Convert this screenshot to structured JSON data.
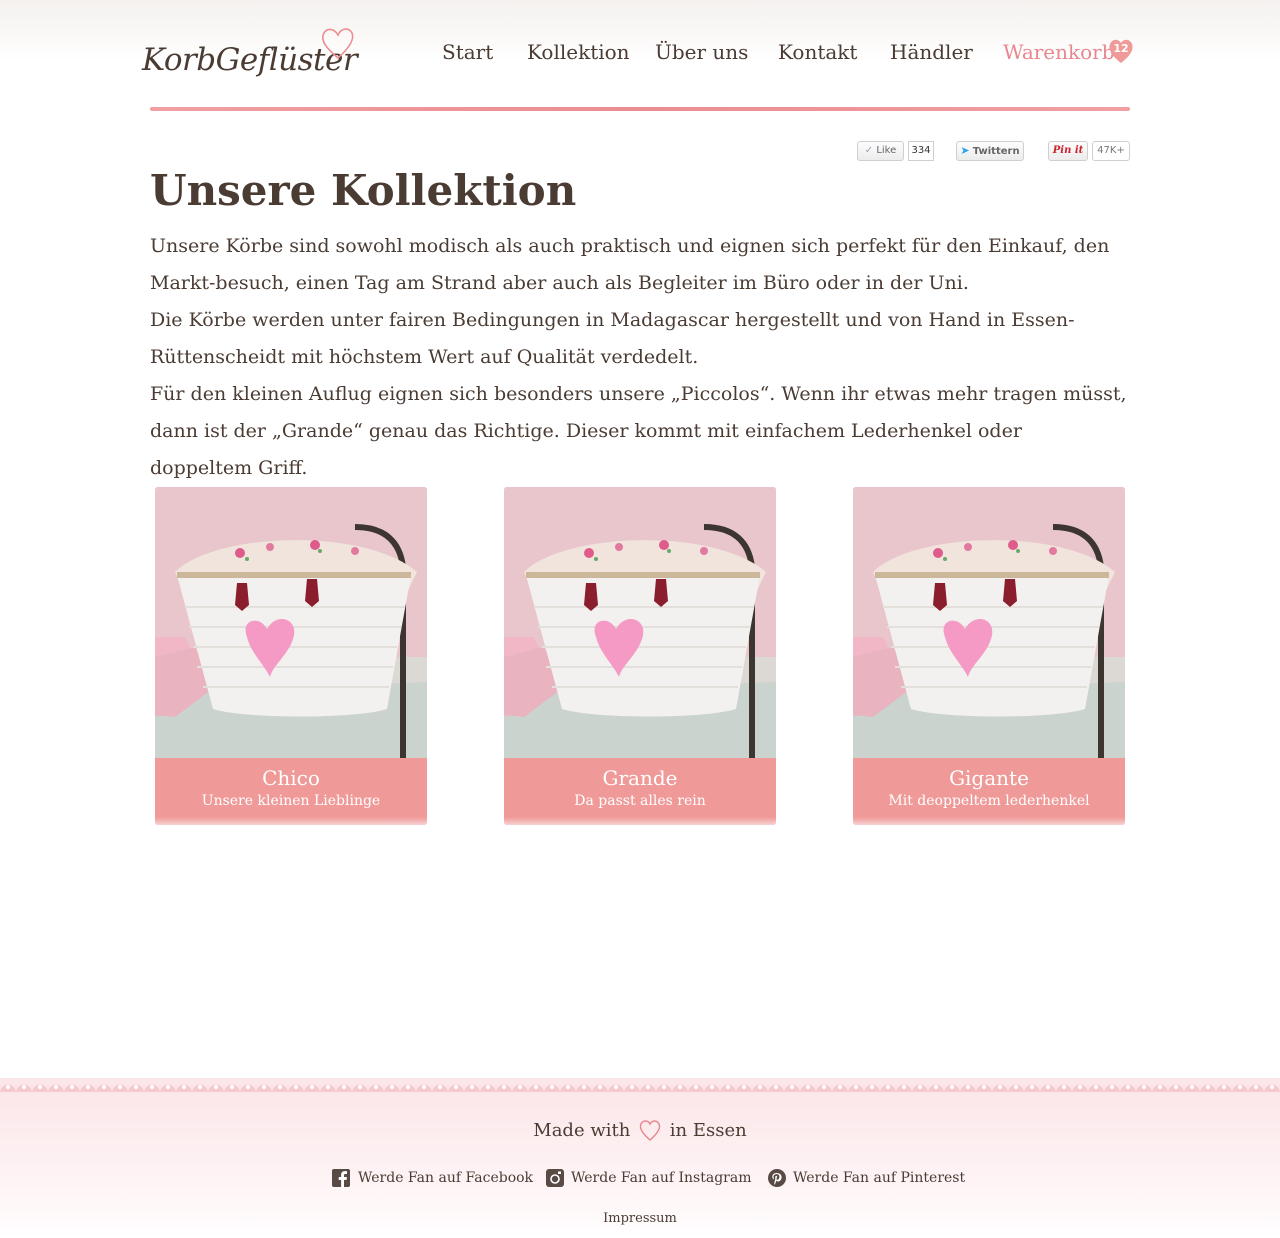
{
  "brand": {
    "logo_text": "KorbGeflüster"
  },
  "nav": {
    "items": [
      {
        "label": "Start"
      },
      {
        "label": "Kollektion"
      },
      {
        "label": "Über uns"
      },
      {
        "label": "Kontakt"
      },
      {
        "label": "Händler"
      }
    ],
    "cart": {
      "label": "Warenkorb",
      "count": "12"
    }
  },
  "social": {
    "like_label": "Like",
    "like_count": "334",
    "tweet_label": "Twittern",
    "pin_label": "Pin it",
    "pin_count": "47K+"
  },
  "main": {
    "title": "Unsere Kollektion",
    "paragraphs": [
      "Unsere Körbe sind sowohl modisch als auch praktisch und eignen sich perfekt für den Einkauf, den Markt-besuch, einen Tag am Strand aber auch als Begleiter im Büro oder in der Uni.",
      "Die Körbe werden unter fairen Bedingungen in Madagascar hergestellt und von Hand in Essen-Rüttenscheidt mit höchstem Wert auf Qualität verdedelt.",
      "Für den kleinen Auflug eignen sich besonders unsere „Piccolos“. Wenn ihr etwas mehr tragen müsst, dann ist der „Grande“ genau das Richtige. Dieser kommt mit einfachem Lederhenkel oder doppeltem Griff."
    ]
  },
  "products": [
    {
      "name": "Chico",
      "subtitle": "Unsere kleinen Lieblinge"
    },
    {
      "name": "Grande",
      "subtitle": "Da passt alles rein"
    },
    {
      "name": "Gigante",
      "subtitle": "Mit deoppeltem lederhenkel"
    }
  ],
  "footer": {
    "made_with_prefix": "Made with",
    "made_with_suffix": "in Essen",
    "links": [
      {
        "label": "Werde Fan auf Facebook",
        "icon": "facebook-icon"
      },
      {
        "label": "Werde Fan auf Instagram",
        "icon": "instagram-icon"
      },
      {
        "label": "Werde Fan auf Pinterest",
        "icon": "pinterest-icon"
      }
    ],
    "impressum": "Impressum"
  },
  "colors": {
    "text": "#4a3b33",
    "accent": "#e8878d",
    "caption_bg": "#ef9a98",
    "heart_pink": "#f4a6c6"
  }
}
